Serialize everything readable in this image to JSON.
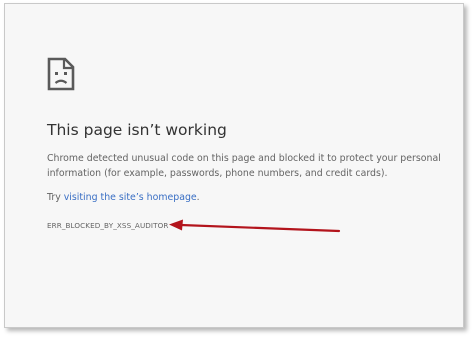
{
  "error_page": {
    "icon": "sad-page-icon",
    "title": "This page isn’t working",
    "description": "Chrome detected unusual code on this page and blocked it to protect your personal information (for example, passwords, phone numbers, and credit cards).",
    "try_prefix": "Try ",
    "try_link": "visiting the site’s homepage",
    "try_suffix": ".",
    "error_code": "ERR_BLOCKED_BY_XSS_AUDITOR"
  },
  "annotation": {
    "arrow_color": "#b3141c"
  },
  "colors": {
    "background": "#f7f7f7",
    "title": "#333333",
    "body_text": "#646464",
    "link": "#3a6fc4"
  }
}
